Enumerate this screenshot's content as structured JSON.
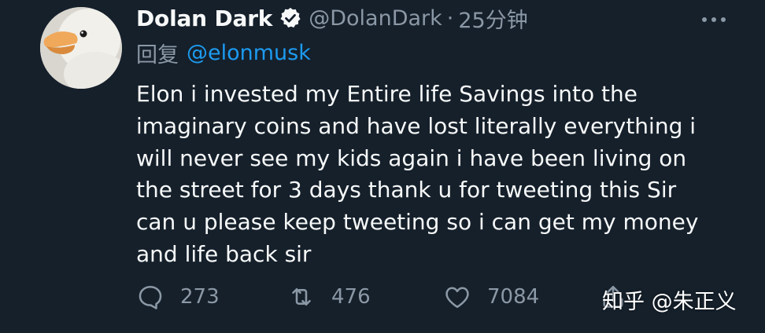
{
  "author": {
    "display_name": "Dolan Dark",
    "handle": "@DolanDark",
    "separator": "·",
    "time": "25分钟",
    "verified": true
  },
  "reply": {
    "label": "回复",
    "mention": "@elonmusk"
  },
  "body_lines": [
    "Elon i invested my Entire life Savings into the",
    "imaginary coins and have lost literally everything i",
    "will never see my kids again i have been living on",
    "the street for 3 days thank u for tweeting this Sir",
    "can u please keep tweeting so i can get my money",
    "and life back sir"
  ],
  "actions": {
    "reply_count": "273",
    "retweet_count": "476",
    "like_count": "7084"
  },
  "icons": {
    "avatar": "duck-avatar",
    "verified": "verified-badge-icon",
    "more": "more-icon",
    "reply": "reply-icon",
    "retweet": "retweet-icon",
    "like": "heart-icon",
    "share": "share-icon"
  },
  "watermark": "知乎 @朱正义",
  "colors": {
    "background": "#15202b",
    "text": "#f7f9f9",
    "secondary": "#8b98a5",
    "link": "#1d9bf0"
  }
}
